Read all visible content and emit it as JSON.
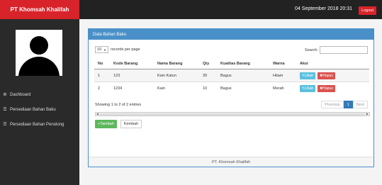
{
  "header": {
    "brand": "PT Khomsah Khalifah",
    "datetime": "04 September 2018 20:31",
    "logout_label": "Logout"
  },
  "sidebar": {
    "items": [
      {
        "label": "Dashboard",
        "icon": "dashboard-icon"
      },
      {
        "label": "Persediaan Bahan Baku",
        "icon": "list-icon"
      },
      {
        "label": "Persediaan Bahan Penolong",
        "icon": "list-icon"
      }
    ]
  },
  "panel": {
    "title": "Data Bahan Baku",
    "length_value": "10",
    "length_suffix": "records per page",
    "search_label": "Search:",
    "search_value": "",
    "columns": [
      "No",
      "Kode Barang",
      "Nama Barang",
      "Qty",
      "Kualitas Barang",
      "Warna",
      "Aksi"
    ],
    "rows": [
      [
        "1",
        "123",
        "Kain Katun",
        "30",
        "Bagus",
        "Hitam"
      ],
      [
        "2",
        "1234",
        "Kain",
        "10",
        "Bagus",
        "Merah"
      ]
    ],
    "ubah_label": "Ubah",
    "hapus_label": "Hapus",
    "info": "Showing 1 to 2 of 2 entries",
    "pager": {
      "prev": "Previous",
      "current": "1",
      "next": "Next"
    },
    "tambah_label": "Tambah",
    "kembali_label": "Kembali",
    "footer": "PT. Khomsah Khalifah"
  },
  "colors": {
    "brand_red": "#d9232a",
    "topbar": "#222222",
    "sidebar": "#2a2a2a",
    "panel_head": "#4a90c8",
    "ubah": "#5bc0de",
    "hapus": "#d9534f",
    "tambah": "#5cb85c"
  }
}
